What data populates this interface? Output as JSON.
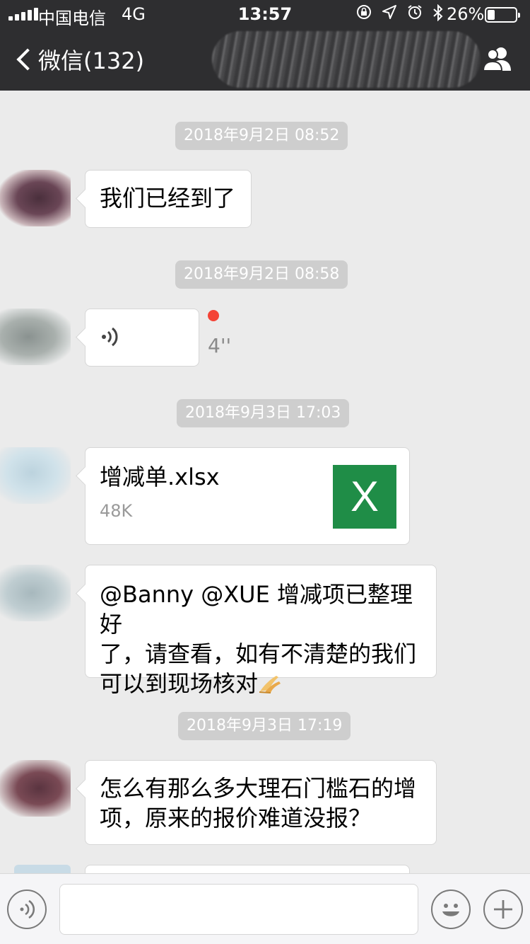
{
  "status_bar": {
    "carrier": "中国电信",
    "network": "4G",
    "time": "13:57",
    "battery_percent_text": "26%",
    "battery_level": 0.26,
    "icons": [
      "orientation-lock-icon",
      "location-arrow-icon",
      "alarm-icon",
      "bluetooth-icon"
    ]
  },
  "nav": {
    "back_label": "微信(132)",
    "title": "",
    "right_icon": "group-members-icon"
  },
  "messages": [
    {
      "time": "2018年9月2日 08:52",
      "type": "text",
      "text": "我们已经到了"
    },
    {
      "time": "2018年9月2日 08:58",
      "type": "voice",
      "duration": "4''",
      "unread": true
    },
    {
      "time": "2018年9月3日 17:03",
      "type": "file",
      "file_name": "增减单.xlsx",
      "file_size": "48K",
      "file_icon_letter": "X",
      "file_icon_color": "#1f8d47"
    },
    {
      "type": "text",
      "text_line1": "@Banny @XUE 增减项已整理好",
      "text_line2": "了，请查看，如有不清楚的我们",
      "text_line3": "可以到现场核对"
    },
    {
      "time": "2018年9月3日 17:19",
      "type": "text",
      "text_line1": "怎么有那么多大理石门槛石的增",
      "text_line2": "项，原来的报价难道没报？"
    }
  ],
  "input_bar": {
    "left_icon": "voice-input-icon",
    "text_value": "",
    "emoji_icon": "emoji-icon",
    "more_icon": "plus-icon"
  },
  "colors": {
    "nav_bg": "#2e2e30",
    "chat_bg": "#ebebeb",
    "timestamp_bg": "#cecece",
    "unread_dot": "#f44336",
    "excel_green": "#1f8d47"
  }
}
